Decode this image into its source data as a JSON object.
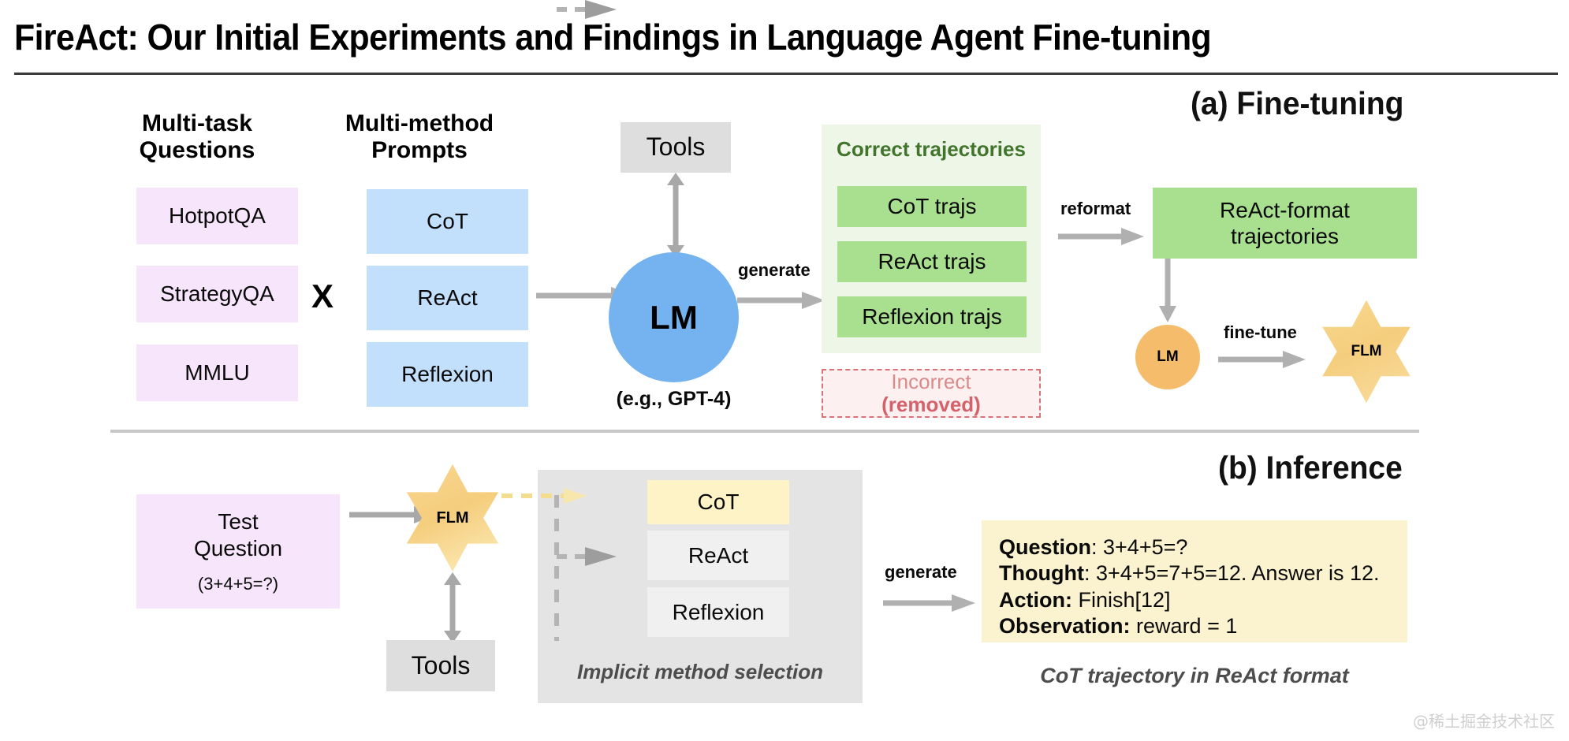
{
  "title": "FireAct: Our Initial Experiments and Findings in Language Agent Fine-tuning",
  "sections": {
    "finetuning_label": "(a) Fine-tuning",
    "inference_label": "(b) Inference"
  },
  "columns": {
    "questions_heading": "Multi-task\nQuestions",
    "prompts_heading": "Multi-method\nPrompts"
  },
  "datasets": [
    {
      "label": "HotpotQA"
    },
    {
      "label": "StrategyQA"
    },
    {
      "label": "MMLU"
    }
  ],
  "multiplier": "X",
  "prompt_methods": [
    {
      "label": "CoT"
    },
    {
      "label": "ReAct"
    },
    {
      "label": "Reflexion"
    }
  ],
  "tools_top": "Tools",
  "lm": {
    "big_label": "LM",
    "big_sublabel": "(e.g., GPT-4)",
    "small_label": "LM"
  },
  "arrows": {
    "generate_top": "generate",
    "reformat": "reformat",
    "fine_tune": "fine-tune",
    "generate_bottom": "generate"
  },
  "correct_panel": {
    "title": "Correct trajectories",
    "items": [
      {
        "label": "CoT trajs"
      },
      {
        "label": "ReAct trajs"
      },
      {
        "label": "Reflexion trajs"
      }
    ]
  },
  "incorrect_box": {
    "line1": "Incorrect",
    "line2": "(removed)"
  },
  "react_format_box": "ReAct-format\ntrajectories",
  "flm_star_top": "FLM",
  "inference": {
    "test_question_title": "Test\nQuestion",
    "test_question_sub": "(3+4+5=?)",
    "flm_label": "FLM",
    "tools_label": "Tools",
    "implicit_label": "Implicit method selection",
    "methods": [
      {
        "label": "CoT",
        "selected": true
      },
      {
        "label": "ReAct",
        "selected": false
      },
      {
        "label": "Reflexion",
        "selected": false
      }
    ],
    "trajectory": {
      "question_key": "Question",
      "question_val": ": 3+4+5=?",
      "thought_key": "Thought",
      "thought_val": ": 3+4+5=7+5=12. Answer is 12.",
      "action_key": "Action:",
      "action_val": " Finish[12]",
      "observation_key": "Observation:",
      "observation_val": " reward = 1"
    },
    "caption": "CoT trajectory in ReAct format"
  },
  "watermark": "@稀土掘金技术社区",
  "colors": {
    "pink": "#f7e6fb",
    "blue": "#c2dffb",
    "green": "#a8e08f",
    "green_panel": "#eef6e8",
    "green_text": "#41752c",
    "gray_box": "#dedede",
    "light_gray_box": "#f0f0f0",
    "panel_gray": "#e4e4e4",
    "yellow_box": "#fdf3c6",
    "trajectory_bg": "#fbf2cf",
    "lm_blue": "#74b3f0",
    "lm_orange": "#f5bd6b",
    "star_gold": "#f6d07f",
    "arrow_gray": "#b0b0b0",
    "incorrect_red": "#d4626b"
  }
}
